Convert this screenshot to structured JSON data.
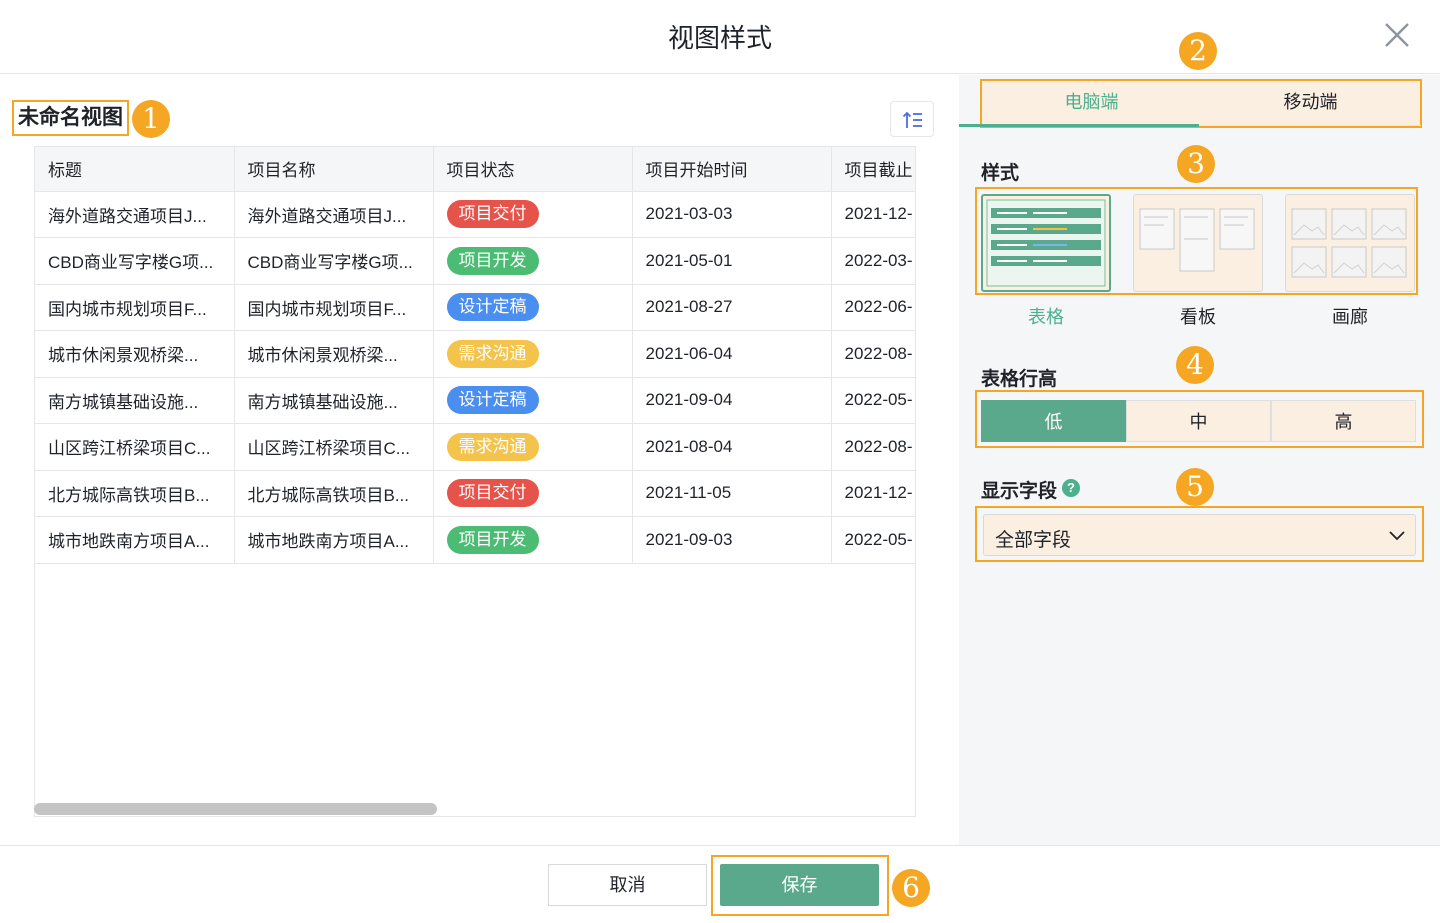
{
  "dialog": {
    "title": "视图样式"
  },
  "view": {
    "name": "未命名视图"
  },
  "badges": [
    "1",
    "2",
    "3",
    "4",
    "5",
    "6"
  ],
  "table": {
    "columns": [
      "标题",
      "项目名称",
      "项目状态",
      "项目开始时间",
      "项目截止"
    ],
    "rows": [
      {
        "title": "海外道路交通项目J...",
        "name": "海外道路交通项目J...",
        "status": "项目交付",
        "status_color": "#e5534b",
        "start": "2021-03-03",
        "end": "2021-12-"
      },
      {
        "title": "CBD商业写字楼G项...",
        "name": "CBD商业写字楼G项...",
        "status": "项目开发",
        "status_color": "#4cbb73",
        "start": "2021-05-01",
        "end": "2022-03-"
      },
      {
        "title": "国内城市规划项目F...",
        "name": "国内城市规划项目F...",
        "status": "设计定稿",
        "status_color": "#4a8ef0",
        "start": "2021-08-27",
        "end": "2022-06-"
      },
      {
        "title": "城市休闲景观桥梁...",
        "name": "城市休闲景观桥梁...",
        "status": "需求沟通",
        "status_color": "#f3c34b",
        "start": "2021-06-04",
        "end": "2022-08-"
      },
      {
        "title": "南方城镇基础设施...",
        "name": "南方城镇基础设施...",
        "status": "设计定稿",
        "status_color": "#4a8ef0",
        "start": "2021-09-04",
        "end": "2022-05-"
      },
      {
        "title": "山区跨江桥梁项目C...",
        "name": "山区跨江桥梁项目C...",
        "status": "需求沟通",
        "status_color": "#f3c34b",
        "start": "2021-08-04",
        "end": "2022-08-"
      },
      {
        "title": "北方城际高铁项目B...",
        "name": "北方城际高铁项目B...",
        "status": "项目交付",
        "status_color": "#e5534b",
        "start": "2021-11-05",
        "end": "2021-12-"
      },
      {
        "title": "城市地跌南方项目A...",
        "name": "城市地跌南方项目A...",
        "status": "项目开发",
        "status_color": "#4cbb73",
        "start": "2021-09-03",
        "end": "2022-05-"
      }
    ]
  },
  "panel": {
    "tabs": [
      {
        "label": "电脑端",
        "active": true
      },
      {
        "label": "移动端",
        "active": false
      }
    ],
    "style_section": "样式",
    "styles": [
      {
        "label": "表格",
        "active": true
      },
      {
        "label": "看板",
        "active": false
      },
      {
        "label": "画廊",
        "active": false
      }
    ],
    "row_height_section": "表格行高",
    "row_heights": [
      {
        "label": "低",
        "active": true
      },
      {
        "label": "中",
        "active": false
      },
      {
        "label": "高",
        "active": false
      }
    ],
    "fields_section": "显示字段",
    "fields_value": "全部字段"
  },
  "footer": {
    "cancel_label": "取消",
    "save_label": "保存"
  },
  "colors": {
    "accent": "#5aa98c",
    "highlight": "#f5a623",
    "tab_active": "#4caf8e"
  }
}
